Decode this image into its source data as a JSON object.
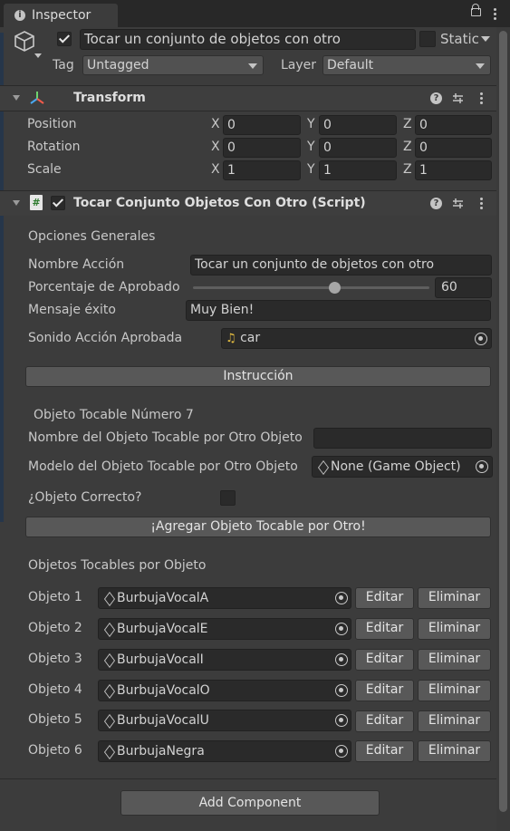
{
  "tab": {
    "title": "Inspector"
  },
  "object": {
    "active": true,
    "name": "Tocar un conjunto de objetos con otro",
    "static_label": "Static",
    "tag_label": "Tag",
    "tag_value": "Untagged",
    "layer_label": "Layer",
    "layer_value": "Default"
  },
  "transform": {
    "title": "Transform",
    "rows": [
      {
        "label": "Position",
        "x": "0",
        "y": "0",
        "z": "0"
      },
      {
        "label": "Rotation",
        "x": "0",
        "y": "0",
        "z": "0"
      },
      {
        "label": "Scale",
        "x": "1",
        "y": "1",
        "z": "1"
      }
    ],
    "axis_x": "X",
    "axis_y": "Y",
    "axis_z": "Z"
  },
  "script": {
    "title": "Tocar Conjunto Objetos Con Otro (Script)",
    "section_general": "Opciones Generales",
    "action_name_label": "Nombre Acción",
    "action_name_value": "Tocar un conjunto de objetos con otro",
    "approval_label": "Porcentaje de Aprobado",
    "approval_value": "60",
    "approval_fraction": 0.6,
    "success_label": "Mensaje éxito",
    "success_value": "Muy Bien!",
    "sound_label": "Sonido Acción Aprobada",
    "sound_value": "car",
    "instruction_button": "Instrucción",
    "touchable_header": "Objeto Tocable Número 7",
    "touch_name_label": "Nombre del Objeto Tocable por Otro Objeto",
    "touch_name_value": "",
    "touch_model_label": "Modelo del Objeto Tocable por Otro Objeto",
    "touch_model_value": "None (Game Object)",
    "correct_label": "¿Objeto Correcto?",
    "add_button": "¡Agregar Objeto Tocable por Otro!",
    "list_header": "Objetos Tocables por Objeto",
    "edit_label": "Editar",
    "delete_label": "Eliminar",
    "objects": [
      {
        "label": "Objeto 1",
        "value": "BurbujaVocalA"
      },
      {
        "label": "Objeto 2",
        "value": "BurbujaVocalE"
      },
      {
        "label": "Objeto 3",
        "value": "BurbujaVocalI"
      },
      {
        "label": "Objeto 4",
        "value": "BurbujaVocalO"
      },
      {
        "label": "Objeto 5",
        "value": "BurbujaVocalU"
      },
      {
        "label": "Objeto 6",
        "value": "BurbujaNegra"
      }
    ]
  },
  "footer": {
    "add_component": "Add Component"
  }
}
